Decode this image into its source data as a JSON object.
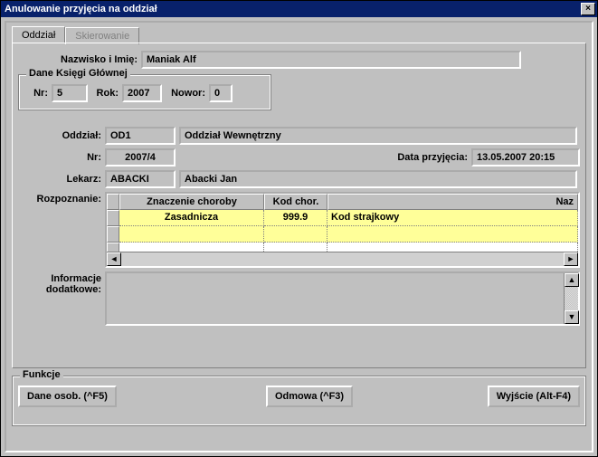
{
  "window": {
    "title": "Anulowanie przyjęcia na oddział",
    "close_glyph": "×"
  },
  "tabs": {
    "oddzial": "Oddział",
    "skierowanie": "Skierowanie"
  },
  "labels": {
    "nazwisko": "Nazwisko i Imię:",
    "dane_ksiegi": "Dane Księgi Głównej",
    "nr_kg": "Nr:",
    "rok": "Rok:",
    "nowor": "Nowor:",
    "oddzial": "Oddział:",
    "nr": "Nr:",
    "data_przyjecia": "Data przyjęcia:",
    "lekarz": "Lekarz:",
    "rozpoznanie": "Rozpoznanie:",
    "info_dodatkowe1": "Informacje",
    "info_dodatkowe2": "dodatkowe:",
    "funkcje": "Funkcje"
  },
  "values": {
    "nazwisko": "Maniak Alf",
    "nr_kg": "5",
    "rok": "2007",
    "nowor": "0",
    "oddzial_kod": "OD1",
    "oddzial_nazwa": "Oddział Wewnętrzny",
    "nr": "2007/4",
    "data_przyjecia": "13.05.2007 20:15",
    "lekarz_kod": "ABACKI",
    "lekarz_nazwa": "Abacki Jan"
  },
  "grid": {
    "headers": {
      "znaczenie": "Znaczenie choroby",
      "kod": "Kod chor.",
      "naz": "Naz"
    },
    "rows": [
      {
        "znaczenie": "Zasadnicza",
        "kod": "999.9",
        "naz": "Kod strajkowy"
      }
    ]
  },
  "scroll": {
    "left": "◄",
    "right": "►",
    "up": "▲",
    "down": "▼"
  },
  "buttons": {
    "dane_osob": "Dane osob. (^F5)",
    "odmowa": "Odmowa (^F3)",
    "wyjscie": "Wyjście (Alt-F4)"
  }
}
